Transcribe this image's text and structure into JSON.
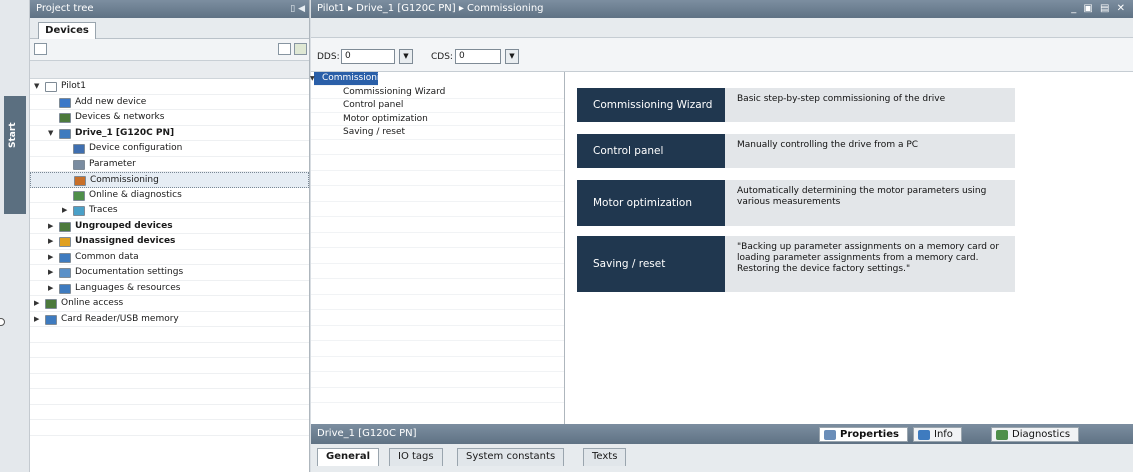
{
  "start_strip": {
    "label": "Start"
  },
  "tree_panel": {
    "title": "Project tree",
    "tab": "Devices",
    "items": [
      {
        "label": "Pilot1",
        "level": 0,
        "expanded": "open",
        "icon_color": "#ffffff",
        "bold": false,
        "selected": false
      },
      {
        "label": "Add new device",
        "level": 1,
        "expanded": "none",
        "icon_color": "#3b78c8",
        "bold": false,
        "selected": false
      },
      {
        "label": "Devices & networks",
        "level": 1,
        "expanded": "none",
        "icon_color": "#4c7a3c",
        "bold": false,
        "selected": false
      },
      {
        "label": "Drive_1 [G120C PN]",
        "level": 1,
        "expanded": "open",
        "icon_color": "#3e7bbf",
        "bold": true,
        "selected": false
      },
      {
        "label": "Device configuration",
        "level": 2,
        "expanded": "none",
        "icon_color": "#3f6fb0",
        "bold": false,
        "selected": false
      },
      {
        "label": "Parameter",
        "level": 2,
        "expanded": "none",
        "icon_color": "#7a8ca0",
        "bold": false,
        "selected": false
      },
      {
        "label": "Commissioning",
        "level": 2,
        "expanded": "none",
        "icon_color": "#c8702a",
        "bold": false,
        "selected": true
      },
      {
        "label": "Online & diagnostics",
        "level": 2,
        "expanded": "none",
        "icon_color": "#4f8f4a",
        "bold": false,
        "selected": false
      },
      {
        "label": "Traces",
        "level": 2,
        "expanded": "closed",
        "icon_color": "#4aa0c8",
        "bold": false,
        "selected": false
      },
      {
        "label": "Ungrouped devices",
        "level": 1,
        "expanded": "closed",
        "icon_color": "#4c7a3c",
        "bold": true,
        "selected": false
      },
      {
        "label": "Unassigned devices",
        "level": 1,
        "expanded": "closed",
        "icon_color": "#e0a020",
        "bold": true,
        "selected": false
      },
      {
        "label": "Common data",
        "level": 1,
        "expanded": "closed",
        "icon_color": "#3e7bbf",
        "bold": false,
        "selected": false
      },
      {
        "label": "Documentation settings",
        "level": 1,
        "expanded": "closed",
        "icon_color": "#5a90c8",
        "bold": false,
        "selected": false
      },
      {
        "label": "Languages & resources",
        "level": 1,
        "expanded": "closed",
        "icon_color": "#3e7bbf",
        "bold": false,
        "selected": false
      },
      {
        "label": "Online access",
        "level": 0,
        "expanded": "closed",
        "icon_color": "#4c7a3c",
        "bold": false,
        "selected": false
      },
      {
        "label": "Card Reader/USB memory",
        "level": 0,
        "expanded": "closed",
        "icon_color": "#3e7bbf",
        "bold": false,
        "selected": false
      }
    ]
  },
  "main": {
    "breadcrumb": "Pilot1  ▸  Drive_1 [G120C PN]  ▸  Commissioning",
    "window_controls": "_ ▣ ▤ ✕",
    "dds_label": "DDS:",
    "dds_value": "0",
    "cds_label": "CDS:",
    "cds_value": "0",
    "nav": {
      "header": "Commissioning",
      "items": [
        "Commissioning Wizard",
        "Control panel",
        "Motor optimization",
        "Saving / reset"
      ]
    },
    "tiles": [
      {
        "button": "Commissioning Wizard",
        "desc": "Basic step-by-step commissioning of the drive"
      },
      {
        "button": "Control panel",
        "desc": "Manually controlling the drive from a PC"
      },
      {
        "button": "Motor optimization",
        "desc": "Automatically determining the motor parameters using various measurements"
      },
      {
        "button": "Saving / reset",
        "desc": "\"Backing up parameter assignments on a memory card or loading parameter assignments from a memory card. Restoring the device factory settings.\""
      }
    ]
  },
  "inspector": {
    "title": "Drive_1 [G120C PN]",
    "properties": "Properties",
    "info": "Info",
    "diagnostics": "Diagnostics",
    "tabs": [
      "General",
      "IO tags",
      "System constants",
      "Texts"
    ]
  }
}
